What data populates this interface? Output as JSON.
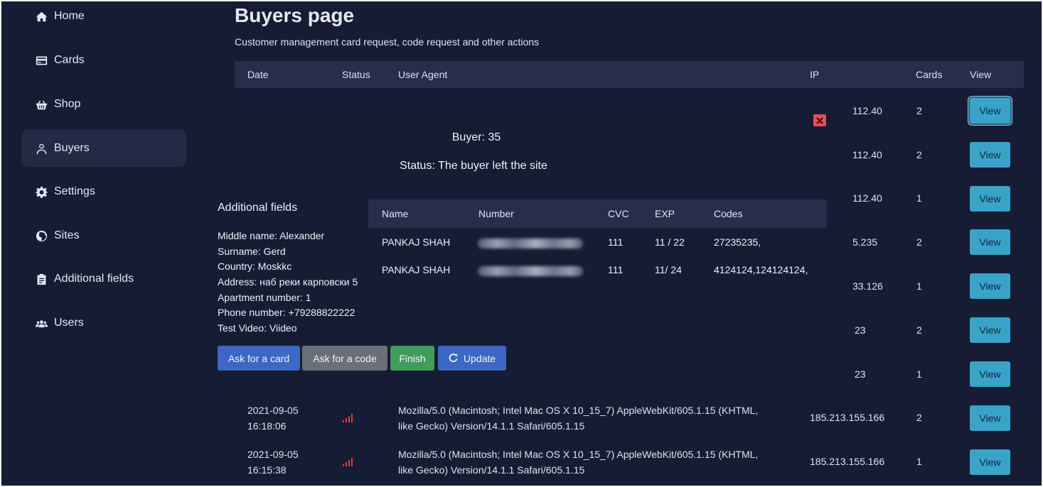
{
  "sidebar": {
    "items": [
      {
        "label": "Home",
        "icon": "home-icon"
      },
      {
        "label": "Cards",
        "icon": "credit-card-icon"
      },
      {
        "label": "Shop",
        "icon": "basket-icon"
      },
      {
        "label": "Buyers",
        "icon": "user-icon",
        "active": true
      },
      {
        "label": "Settings",
        "icon": "gear-icon"
      },
      {
        "label": "Sites",
        "icon": "globe-icon"
      },
      {
        "label": "Additional fields",
        "icon": "clipboard-icon"
      },
      {
        "label": "Users",
        "icon": "users-icon"
      }
    ]
  },
  "page": {
    "title": "Buyers page",
    "subtitle": "Customer management card request, code request and other actions"
  },
  "table": {
    "columns": {
      "date": "Date",
      "status": "Status",
      "user_agent": "User Agent",
      "ip": "IP",
      "cards": "Cards",
      "view": "View"
    },
    "view_label": "View",
    "partial_rows": [
      {
        "ip": "112.40",
        "cards": "2"
      },
      {
        "ip": "112.40",
        "cards": "2"
      },
      {
        "ip": "112.40",
        "cards": "1"
      },
      {
        "ip": "5.235",
        "cards": "2"
      },
      {
        "ip": "33.126",
        "cards": "1"
      },
      {
        "ip": "23",
        "cards": "2"
      },
      {
        "ip": "23",
        "cards": "1"
      }
    ],
    "full_rows": [
      {
        "date": "2021-09-05",
        "time": "16:18:06",
        "ua_line1": "Mozilla/5.0 (Macintosh; Intel Mac OS X 10_15_7) AppleWebKit/605.1.15 (KHTML,",
        "ua_line2": "like Gecko) Version/14.1.1 Safari/605.1.15",
        "ip": "185.213.155.166",
        "cards": "2"
      },
      {
        "date": "2021-09-05",
        "time": "16:15:38",
        "ua_line1": "Mozilla/5.0 (Macintosh; Intel Mac OS X 10_15_7) AppleWebKit/605.1.15 (KHTML,",
        "ua_line2": "like Gecko) Version/14.1.1 Safari/605.1.15",
        "ip": "185.213.155.166",
        "cards": "1"
      }
    ],
    "status_color": "#e53935"
  },
  "modal": {
    "buyer": "Buyer: 35",
    "status": "Status: The buyer left the site",
    "fields_title": "Additional fields",
    "fields": [
      "Middle name: Alexander",
      "Surname: Gerd",
      "Country: Moskkc",
      "Address: наб реки карповски 5",
      "Apartment number: 1",
      "Phone number: +79288822222",
      "Test Video: Viideo"
    ],
    "card_columns": {
      "name": "Name",
      "number": "Number",
      "cvc": "CVC",
      "exp": "EXP",
      "codes": "Codes"
    },
    "cards": [
      {
        "name": "PANKAJ SHAH",
        "cvc": "111",
        "exp": "11 / 22",
        "codes": "27235235,"
      },
      {
        "name": "PANKAJ SHAH",
        "cvc": "111",
        "exp": "11/ 24",
        "codes": "4124124,124124124,"
      }
    ],
    "buttons": {
      "ask_card": "Ask for a card",
      "ask_code": "Ask for a code",
      "finish": "Finish",
      "update": "Update"
    },
    "close_color": "#e0525a"
  },
  "colors": {
    "background": "#161c33",
    "header": "#262e4b",
    "accent_view": "#3aa3c9",
    "primary": "#3c67c4",
    "success": "#3f9c5a",
    "secondary": "#6b6f78"
  }
}
